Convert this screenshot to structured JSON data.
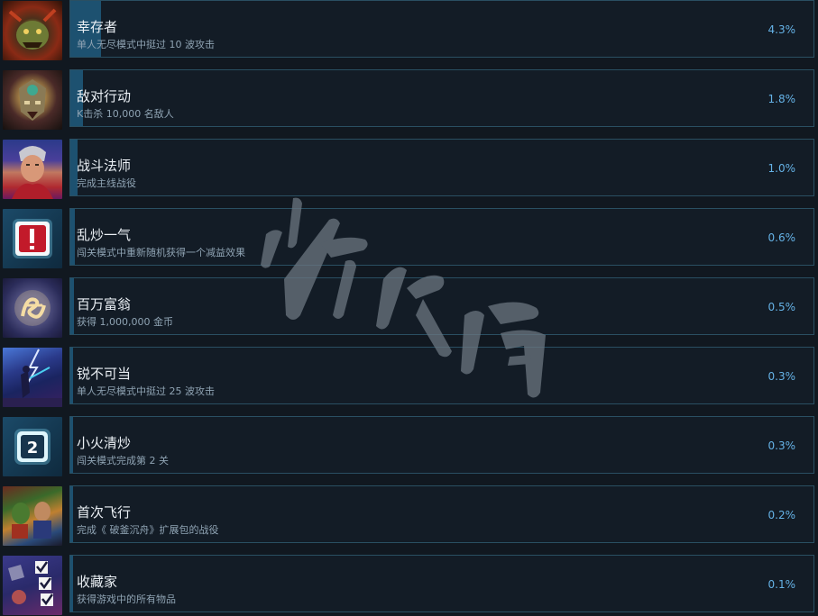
{
  "achievements": [
    {
      "name": "幸存者",
      "desc": "单人无尽模式中挺过 10 波攻击",
      "percent": "4.3%",
      "unlock_fraction": 0.043,
      "icon": "goblin-portrait-icon"
    },
    {
      "name": "敌对行动",
      "desc": "K击杀 10,000 名敌人",
      "percent": "1.8%",
      "unlock_fraction": 0.018,
      "icon": "masked-warrior-icon"
    },
    {
      "name": "战斗法师",
      "desc": "完成主线战役",
      "percent": "1.0%",
      "unlock_fraction": 0.01,
      "icon": "hero-portrait-icon"
    },
    {
      "name": "乱炒一气",
      "desc": "闯关模式中重新随机获得一个减益效果",
      "percent": "0.6%",
      "unlock_fraction": 0.006,
      "icon": "exclamation-card-icon"
    },
    {
      "name": "百万富翁",
      "desc": "获得 1,000,000 金币",
      "percent": "0.5%",
      "unlock_fraction": 0.005,
      "icon": "gold-coin-icon"
    },
    {
      "name": "锐不可当",
      "desc": "单人无尽模式中挺过 25 波攻击",
      "percent": "0.3%",
      "unlock_fraction": 0.003,
      "icon": "storm-battle-icon"
    },
    {
      "name": "小火清炒",
      "desc": "闯关模式完成第 2 关",
      "percent": "0.3%",
      "unlock_fraction": 0.003,
      "icon": "number-two-icon"
    },
    {
      "name": "首次飞行",
      "desc": "完成《 破釜沉舟》扩展包的战役",
      "percent": "0.2%",
      "unlock_fraction": 0.002,
      "icon": "flight-scene-icon"
    },
    {
      "name": "收藏家",
      "desc": "获得游戏中的所有物品",
      "percent": "0.1%",
      "unlock_fraction": 0.001,
      "icon": "checklist-icon"
    }
  ],
  "watermark_text": "游侠网",
  "colors": {
    "accent": "#65b2e6",
    "fill": "#1d5170",
    "border": "#2a4f62",
    "background": "#111820"
  }
}
